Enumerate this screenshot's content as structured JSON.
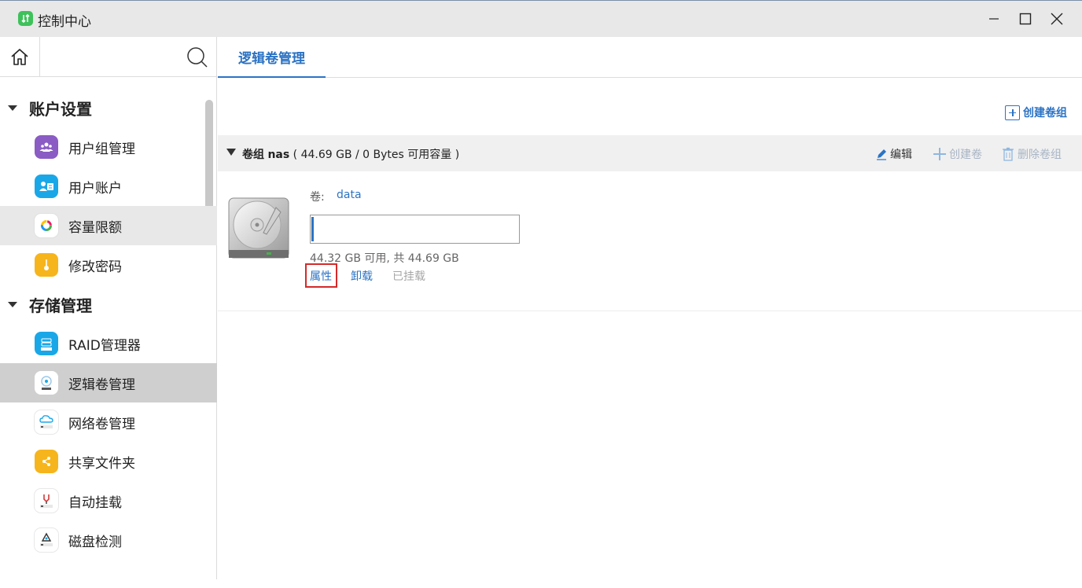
{
  "window": {
    "title": "控制中心",
    "accent": "#2b73c4",
    "app_icon_color": "#3ec15a"
  },
  "sidebar": {
    "groups": [
      {
        "label": "账户设置",
        "items": [
          {
            "label": "用户组管理",
            "icon": "user-group-icon",
            "color": "#8a5cc4"
          },
          {
            "label": "用户账户",
            "icon": "user-account-icon",
            "color": "#1aa7e8"
          },
          {
            "label": "容量限额",
            "icon": "quota-icon",
            "color": "#ffffff"
          },
          {
            "label": "修改密码",
            "icon": "password-icon",
            "color": "#f6b51d"
          }
        ]
      },
      {
        "label": "存储管理",
        "items": [
          {
            "label": "RAID管理器",
            "icon": "raid-icon",
            "color": "#1aa7e8"
          },
          {
            "label": "逻辑卷管理",
            "icon": "lvm-icon",
            "color": "#ffffff"
          },
          {
            "label": "网络卷管理",
            "icon": "network-volume-icon",
            "color": "#ffffff"
          },
          {
            "label": "共享文件夹",
            "icon": "share-folder-icon",
            "color": "#f6b51d"
          },
          {
            "label": "自动挂载",
            "icon": "auto-mount-icon",
            "color": "#ffffff"
          },
          {
            "label": "磁盘检测",
            "icon": "disk-check-icon",
            "color": "#ffffff"
          }
        ]
      }
    ]
  },
  "main": {
    "tab": "逻辑卷管理",
    "create_group": "创建卷组",
    "volume_group": {
      "prefix": "卷组",
      "name": "nas",
      "summary": "( 44.69 GB / 0 Bytes 可用容量 )",
      "actions": {
        "edit": "编辑",
        "create_volume": "创建卷",
        "delete_group": "删除卷组"
      }
    },
    "volume": {
      "label": "卷:",
      "name": "data",
      "used_fraction": 0.008,
      "capacity": "44.32 GB 可用, 共 44.69 GB",
      "links": {
        "properties": "属性",
        "unmount": "卸载",
        "mounted": "已挂载"
      }
    }
  }
}
